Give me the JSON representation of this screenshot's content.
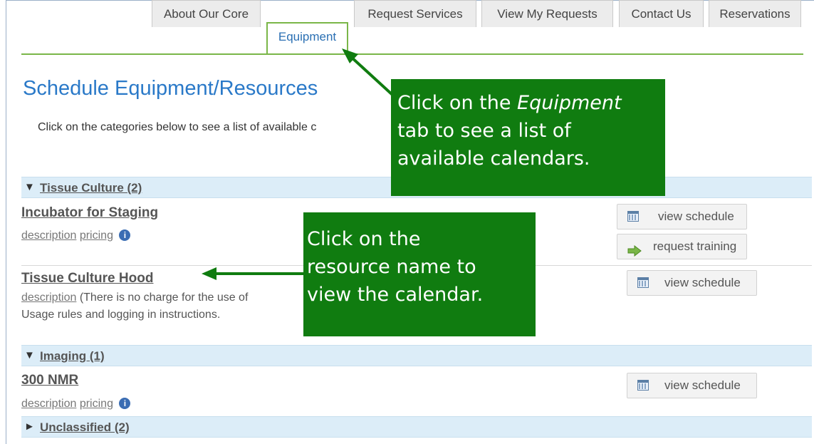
{
  "tabs": [
    {
      "label": "About Our Core"
    },
    {
      "label": "Equipment"
    },
    {
      "label": "Request Services"
    },
    {
      "label": "View My Requests"
    },
    {
      "label": "Contact Us"
    },
    {
      "label": "Reservations"
    }
  ],
  "active_tab": "Equipment",
  "page_title": "Schedule Equipment/Resources",
  "intro_text": "Click on the categories below to see a list of available c",
  "categories": [
    {
      "label": "Tissue Culture (2)",
      "expanded": true,
      "resources": [
        {
          "name": "Incubator for Staging",
          "description_link": "description",
          "pricing_link": "pricing",
          "buttons": [
            "view schedule",
            "request training"
          ]
        },
        {
          "name": "Tissue Culture Hood",
          "description_link": "description",
          "note_line1": "(There is no charge for the use of",
          "note_line2": "Usage rules and logging in instructions.",
          "buttons": [
            "view schedule"
          ]
        }
      ]
    },
    {
      "label": "Imaging (1)",
      "expanded": true,
      "resources": [
        {
          "name": "300 NMR",
          "description_link": "description",
          "pricing_link": "pricing",
          "buttons": [
            "view schedule"
          ]
        }
      ]
    },
    {
      "label": "Unclassified (2)",
      "expanded": false
    }
  ],
  "arrows": {
    "expanded": "▼",
    "collapsed": "►"
  },
  "info_glyph": "i",
  "callouts": {
    "equipment": {
      "pre": "Click on the ",
      "emphasis": "Equipment",
      "line2": "tab to see a list of",
      "line3": "available calendars."
    },
    "resource": {
      "line1": "Click on the",
      "line2": "resource name to",
      "line3": "view the calendar."
    }
  },
  "colors": {
    "accent_green": "#7ab648",
    "callout_green": "#107c10",
    "title_blue": "#2a79c8",
    "category_bg": "#dcedf8"
  },
  "icons": {
    "calendar": "calendar-icon",
    "training": "green-arrow-icon",
    "info": "info-icon"
  }
}
